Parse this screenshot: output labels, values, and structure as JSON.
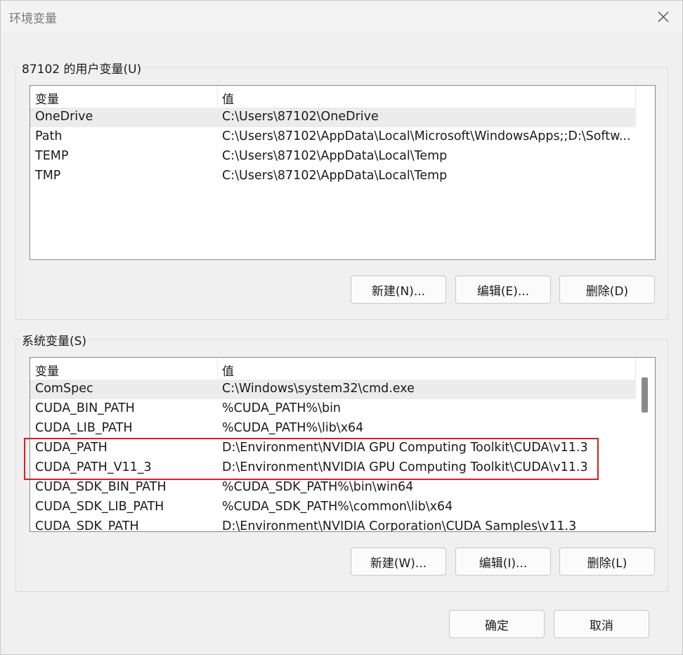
{
  "window": {
    "title": "环境变量"
  },
  "user_vars": {
    "label": "87102 的用户变量(U)",
    "columns": {
      "name": "变量",
      "value": "值"
    },
    "rows": [
      {
        "name": "OneDrive",
        "value": "C:\\Users\\87102\\OneDrive"
      },
      {
        "name": "Path",
        "value": "C:\\Users\\87102\\AppData\\Local\\Microsoft\\WindowsApps;;D:\\Softw..."
      },
      {
        "name": "TEMP",
        "value": "C:\\Users\\87102\\AppData\\Local\\Temp"
      },
      {
        "name": "TMP",
        "value": "C:\\Users\\87102\\AppData\\Local\\Temp"
      }
    ],
    "buttons": {
      "new": "新建(N)...",
      "edit": "编辑(E)...",
      "delete": "删除(D)"
    }
  },
  "system_vars": {
    "label": "系统变量(S)",
    "columns": {
      "name": "变量",
      "value": "值"
    },
    "rows": [
      {
        "name": "ComSpec",
        "value": "C:\\Windows\\system32\\cmd.exe"
      },
      {
        "name": "CUDA_BIN_PATH",
        "value": "%CUDA_PATH%\\bin"
      },
      {
        "name": "CUDA_LIB_PATH",
        "value": "%CUDA_PATH%\\lib\\x64"
      },
      {
        "name": "CUDA_PATH",
        "value": "D:\\Environment\\NVIDIA GPU Computing Toolkit\\CUDA\\v11.3"
      },
      {
        "name": "CUDA_PATH_V11_3",
        "value": "D:\\Environment\\NVIDIA GPU Computing Toolkit\\CUDA\\v11.3"
      },
      {
        "name": "CUDA_SDK_BIN_PATH",
        "value": "%CUDA_SDK_PATH%\\bin\\win64"
      },
      {
        "name": "CUDA_SDK_LIB_PATH",
        "value": "%CUDA_SDK_PATH%\\common\\lib\\x64"
      },
      {
        "name": "CUDA_SDK_PATH",
        "value": "D:\\Environment\\NVIDIA Corporation\\CUDA Samples\\v11.3"
      }
    ],
    "buttons": {
      "new": "新建(W)...",
      "edit": "编辑(I)...",
      "delete": "删除(L)"
    }
  },
  "footer": {
    "ok": "确定",
    "cancel": "取消"
  },
  "colors": {
    "highlight": "#d82020",
    "selected_row": "#ececec"
  },
  "icons": {
    "close": "close-icon"
  }
}
